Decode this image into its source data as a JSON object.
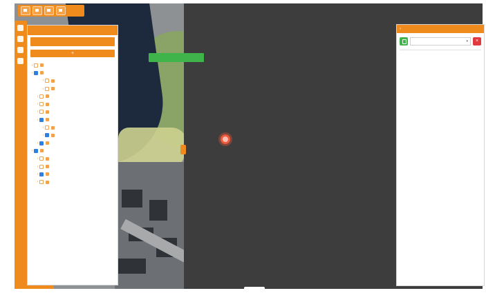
{
  "toolbar": {
    "buttons": [
      "home-icon",
      "layers-icon",
      "pin-icon",
      "camera-icon"
    ]
  },
  "side_rail": {
    "icons": [
      "plus-icon",
      "minus-icon",
      "print-icon",
      "info-icon"
    ]
  },
  "left_panel": {
    "header": "",
    "tabs": [
      {
        "label": ""
      },
      {
        "label": ""
      }
    ],
    "add_label": "+",
    "tree": [
      {
        "label": "",
        "indent": 0,
        "check": false
      },
      {
        "label": "",
        "indent": 0,
        "check": true
      },
      {
        "label": "",
        "indent": 2,
        "check": false
      },
      {
        "label": "",
        "indent": 2,
        "check": false
      },
      {
        "label": "",
        "indent": 1,
        "check": false
      },
      {
        "label": "",
        "indent": 1,
        "check": false
      },
      {
        "label": "",
        "indent": 1,
        "check": false
      },
      {
        "label": "",
        "indent": 1,
        "check": true
      },
      {
        "label": "",
        "indent": 2,
        "check": false
      },
      {
        "label": "",
        "indent": 2,
        "check": true
      },
      {
        "label": "",
        "indent": 1,
        "check": true
      },
      {
        "label": "",
        "indent": 0,
        "check": true
      },
      {
        "label": "",
        "indent": 1,
        "check": false
      },
      {
        "label": "",
        "indent": 1,
        "check": false
      },
      {
        "label": "",
        "indent": 1,
        "check": true
      },
      {
        "label": "",
        "indent": 1,
        "check": false
      }
    ]
  },
  "right_panel": {
    "header": "",
    "select_value": "",
    "title": "",
    "lines": [
      "",
      ""
    ]
  },
  "colors": {
    "accent": "#ef8a1d",
    "confirm": "#3fb44a",
    "danger": "#e0393e",
    "checkbox": "#2f7fe0"
  }
}
